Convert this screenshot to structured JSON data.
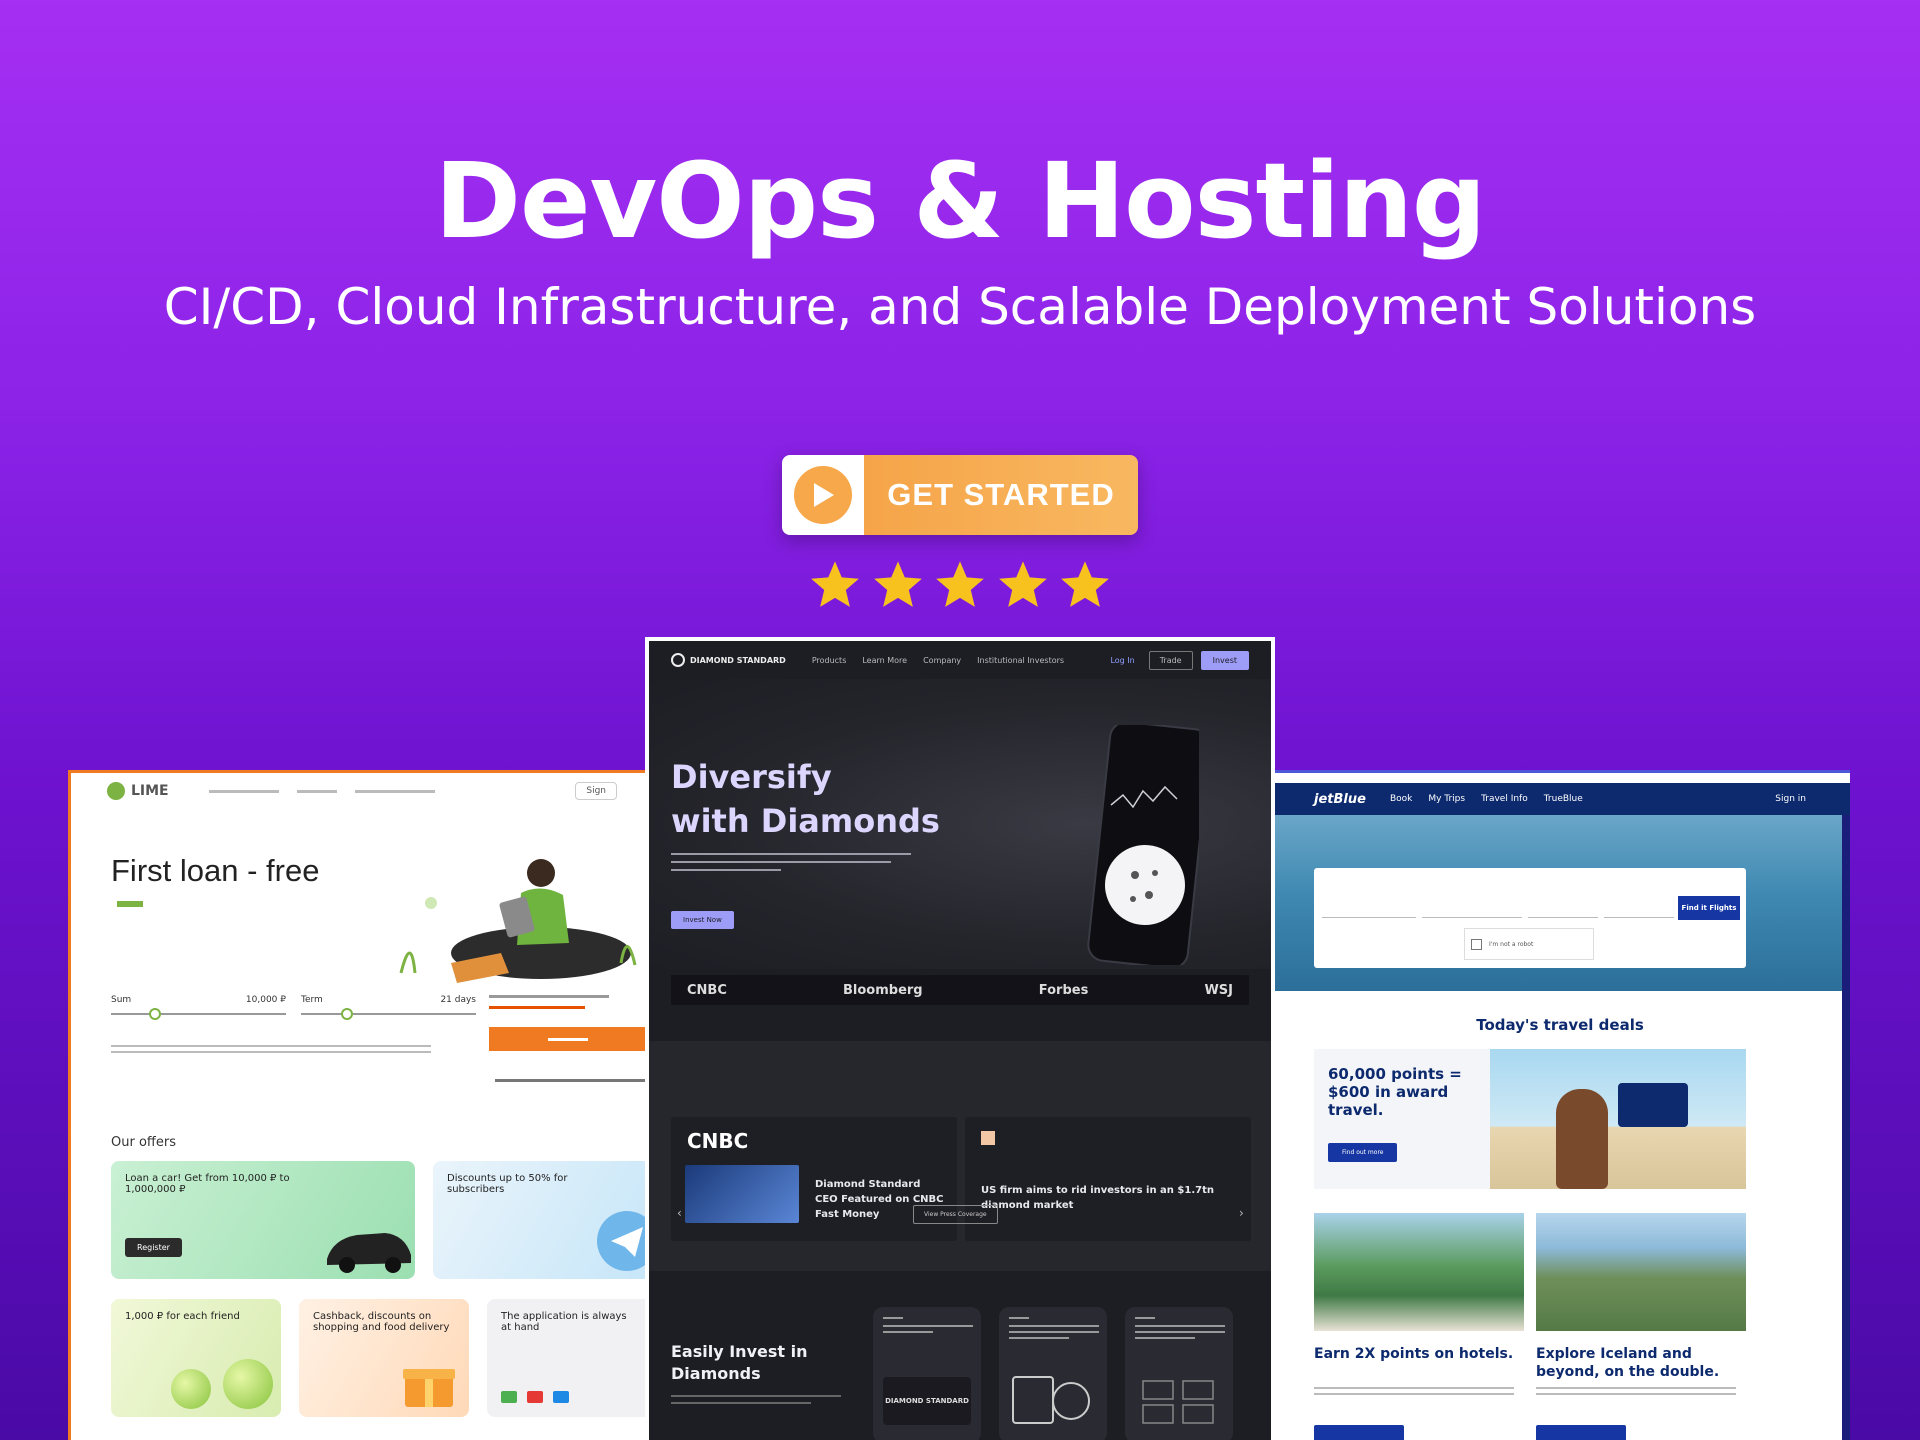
{
  "hero": {
    "title": "DevOps & Hosting",
    "subtitle": "CI/CD, Cloud Infrastructure, and Scalable Deployment Solutions",
    "cta_label": "GET STARTED",
    "rating_stars": 5
  },
  "loan_site": {
    "logo": "LIME",
    "nav_button": "Sign",
    "headline": "First loan - free",
    "amount_label": "Sum",
    "amount_value": "10,000 ₽",
    "term_label": "Term",
    "term_value": "21 days",
    "offers_heading": "Our offers",
    "offer_1_title": "Loan a car! Get from 10,000 ₽ to 1,000,000 ₽",
    "offer_1_button": "Register",
    "offer_2_title": "Discounts up to 50% for subscribers",
    "offer_3_title": "1,000 ₽ for each friend",
    "offer_4_title": "Cashback, discounts on shopping and food delivery",
    "offer_5_title": "The application is always at hand"
  },
  "diamond_site": {
    "logo": "DIAMOND STANDARD",
    "nav": [
      "Products",
      "Learn More",
      "Company",
      "Institutional Investors"
    ],
    "login": "Log In",
    "nav_button_1": "Trade",
    "nav_button_2": "Invest",
    "hero_title_line1": "Diversify",
    "hero_title_line2": "with Diamonds",
    "hero_button": "Invest Now",
    "press": [
      "CNBC",
      "Bloomberg",
      "Forbes",
      "WSJ"
    ],
    "news_1_source": "CNBC",
    "news_1_title": "Diamond Standard CEO Featured on CNBC Fast Money",
    "news_2_title": "US firm aims to rid investors in an $1.7tn diamond market",
    "more_button": "View Press Coverage",
    "section_title_line1": "Easily Invest in",
    "section_title_line2": "Diamonds",
    "feature_brand": "DIAMOND STANDARD"
  },
  "travel_site": {
    "logo": "jetBlue",
    "nav": [
      "Book",
      "My Trips",
      "Travel Info",
      "TrueBlue"
    ],
    "signin": "Sign in",
    "search_button": "Find it Flights",
    "captcha_label": "I'm not a robot",
    "deals_heading": "Today's travel deals",
    "promo_title": "60,000 points = $600 in award travel.",
    "promo_button": "Find out more",
    "tile_1_title": "Earn 2X points on hotels.",
    "tile_2_title": "Explore Iceland and beyond, on the double."
  },
  "colors": {
    "cta_orange": "#f6a449",
    "star_gold": "#f8c21e",
    "loan_green": "#7cb342",
    "loan_orange": "#ef7a22",
    "diamond_accent": "#9d9cf7",
    "travel_navy": "#0d2a6e"
  }
}
